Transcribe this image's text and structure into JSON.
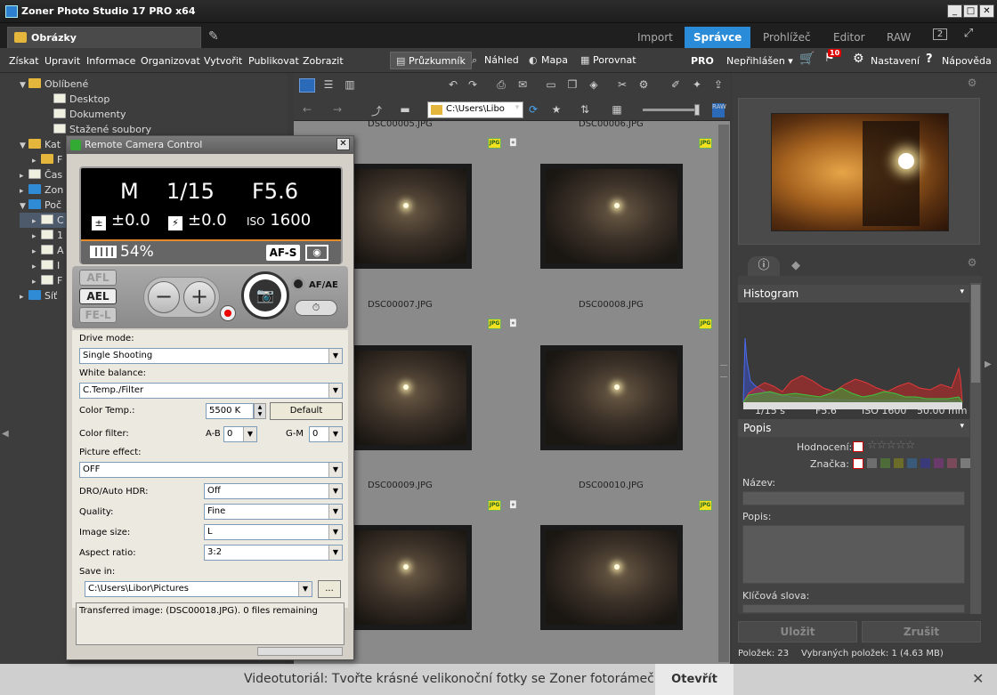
{
  "window": {
    "title": "Zoner Photo Studio 17 PRO x64",
    "min": "_",
    "max": "□",
    "close": "✕"
  },
  "doc_tab": {
    "label": "Obrázky"
  },
  "modules": [
    {
      "label": "Import"
    },
    {
      "label": "Správce"
    },
    {
      "label": "Prohlížeč"
    },
    {
      "label": "Editor"
    },
    {
      "label": "RAW"
    }
  ],
  "topright_badge": "2",
  "menu": {
    "items": [
      "Získat",
      "Upravit",
      "Informace",
      "Organizovat",
      "Vytvořit",
      "Publikovat",
      "Zobrazit"
    ]
  },
  "view_buttons": [
    {
      "label": "Průzkumník"
    },
    {
      "label": "Náhled"
    },
    {
      "label": "Mapa"
    },
    {
      "label": "Porovnat"
    }
  ],
  "account": {
    "pro": "PRO",
    "login": "Nepřihlášen",
    "notify_count": "10",
    "settings": "Nastavení",
    "help": "Nápověda"
  },
  "tree": [
    {
      "label": "Oblíbené",
      "arrow": "▼",
      "indent": 0,
      "icon": "star-folder"
    },
    {
      "label": "Desktop",
      "arrow": "",
      "indent": 2,
      "icon": "doc"
    },
    {
      "label": "Dokumenty",
      "arrow": "",
      "indent": 2,
      "icon": "doc"
    },
    {
      "label": "Stažené soubory",
      "arrow": "",
      "indent": 2,
      "icon": "doc"
    },
    {
      "label": "Kat",
      "arrow": "▼",
      "indent": 0,
      "icon": "star-folder"
    },
    {
      "label": "F",
      "arrow": "▸",
      "indent": 1,
      "icon": "folder"
    },
    {
      "label": "Čas",
      "arrow": "▸",
      "indent": 0,
      "icon": "calendar"
    },
    {
      "label": "Zon",
      "arrow": "▸",
      "indent": 0,
      "icon": "zoner"
    },
    {
      "label": "Poč",
      "arrow": "▼",
      "indent": 0,
      "icon": "computer"
    },
    {
      "label": "C",
      "arrow": "▸",
      "indent": 1,
      "icon": "drive"
    },
    {
      "label": "1",
      "arrow": "▸",
      "indent": 1,
      "icon": "drive"
    },
    {
      "label": "A",
      "arrow": "▸",
      "indent": 1,
      "icon": "drive"
    },
    {
      "label": "I",
      "arrow": "▸",
      "indent": 1,
      "icon": "drive"
    },
    {
      "label": "F",
      "arrow": "▸",
      "indent": 1,
      "icon": "drive"
    },
    {
      "label": "Síť",
      "arrow": "▸",
      "indent": 0,
      "icon": "network"
    }
  ],
  "path": {
    "value": "C:\\Users\\Libo"
  },
  "thumbs": [
    {
      "name": "DSC00005.JPG",
      "warm": false
    },
    {
      "name": "DSC00006.JPG",
      "warm": false
    },
    {
      "name": "DSC00007.JPG",
      "warm": false
    },
    {
      "name": "DSC00008.JPG",
      "warm": false
    },
    {
      "name": "DSC00009.JPG",
      "warm": false
    },
    {
      "name": "DSC00010.JPG",
      "warm": false
    },
    {
      "name": "",
      "warm": false
    },
    {
      "name": "",
      "warm": true
    }
  ],
  "jpg_badge": "JPG",
  "right": {
    "histogram_title": "Histogram",
    "exif": {
      "shutter": "1/15 s",
      "aperture": "F5.6",
      "iso": "ISO 1600",
      "focal": "50.00 mm"
    },
    "desc_title": "Popis",
    "rating_label": "Hodnocení:",
    "tag_label": "Značka:",
    "name_label": "Název:",
    "desc_label": "Popis:",
    "keywords_label": "Klíčová slova:",
    "save": "Uložit",
    "cancel": "Zrušit",
    "status_count": "Položek: 23",
    "status_selected": "Vybraných položek: 1 (4.63 MB)",
    "tag_colors": [
      "#6e6e6e",
      "#4e6b3a",
      "#6b6b2a",
      "#3a5a7a",
      "#3a3a7a",
      "#6a3a6a",
      "#7a4a5a",
      "#7a7a7a"
    ]
  },
  "rcc": {
    "title": "Remote Camera Control",
    "mode": "M",
    "shutter": "1/15",
    "aperture": "F5.6",
    "ev": "±0.0",
    "flash_ev": "±0.0",
    "iso_label": "ISO",
    "iso": "1600",
    "battery": "54%",
    "af": "AF-S",
    "afl": "AFL",
    "ael": "AEL",
    "fel": "FE-L",
    "afae": "AF/AE",
    "drive_label": "Drive mode:",
    "drive": "Single Shooting",
    "wb_label": "White balance:",
    "wb": "C.Temp./Filter",
    "ct_label": "Color Temp.:",
    "ct": "5500 K",
    "default_btn": "Default",
    "cf_label": "Color filter:",
    "ab_label": "A-B",
    "ab": "0",
    "gm_label": "G-M",
    "gm": "0",
    "pe_label": "Picture effect:",
    "pe": "OFF",
    "dro_label": "DRO/Auto HDR:",
    "dro": "Off",
    "quality_label": "Quality:",
    "quality": "Fine",
    "size_label": "Image size:",
    "size": "L",
    "aspect_label": "Aspect ratio:",
    "aspect": "3:2",
    "save_label": "Save in:",
    "save_path": "C:\\Users\\Libor\\Pictures",
    "browse": "...",
    "log": "Transferred image: (DSC00018.JPG). 0 files remaining"
  },
  "bottom": {
    "message": "Videotutoriál: Tvořte krásné velikonoční fotky se Zoner fotorámečky",
    "open": "Otevřít",
    "close": "✕"
  }
}
